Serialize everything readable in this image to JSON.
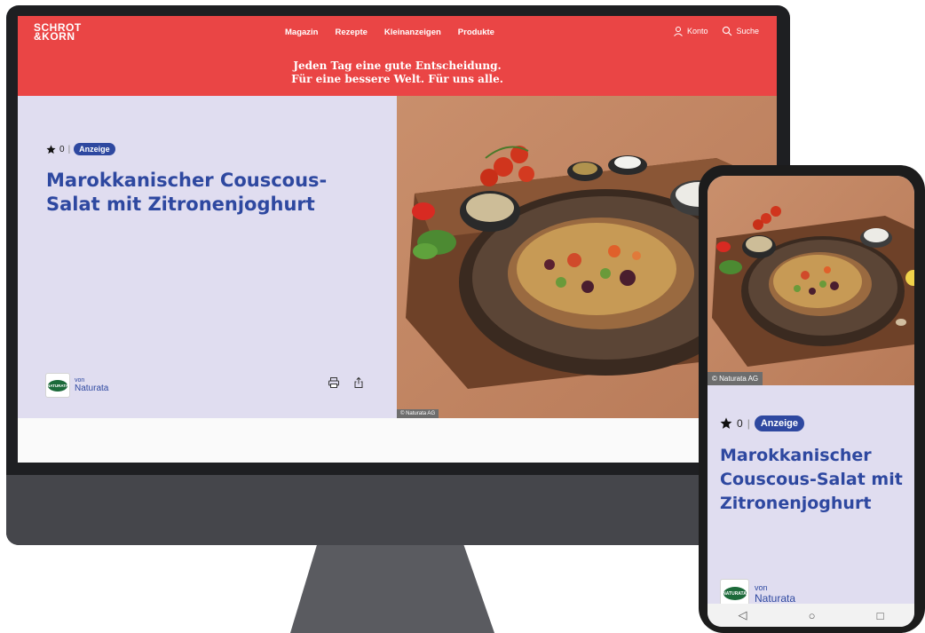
{
  "site": {
    "logo_line1": "SCHROT",
    "logo_line2": "&KORN",
    "nav": [
      "Magazin",
      "Rezepte",
      "Kleinanzeigen",
      "Produkte"
    ],
    "account_label": "Konto",
    "search_label": "Suche",
    "tagline_line1": "Jeden Tag eine gute Entscheidung.",
    "tagline_line2": "Für eine bessere Welt. Für uns alle."
  },
  "recipe": {
    "rating_count": "0",
    "separator": "|",
    "badge": "Anzeige",
    "title": "Marokkanischer Couscous-Salat mit Zitronenjoghurt",
    "by_label": "von",
    "brand": "Naturata",
    "brand_logo_text": "NATURATA",
    "photo_credit": "© Naturata AG"
  },
  "phone_nav": [
    "◁",
    "○",
    "□"
  ],
  "colors": {
    "header_red": "#ea4545",
    "hero_lavender": "#e0ddf0",
    "title_blue": "#2e48a0"
  },
  "icons": [
    "star-icon",
    "user-icon",
    "search-icon",
    "print-icon",
    "share-icon"
  ]
}
